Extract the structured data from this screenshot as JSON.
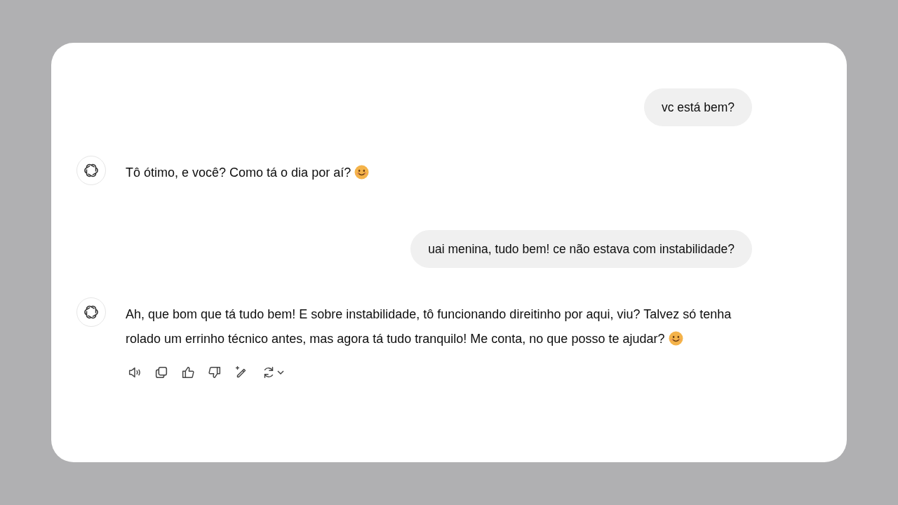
{
  "messages": [
    {
      "kind": "user",
      "text": "vc está bem?"
    },
    {
      "kind": "assistant",
      "text": "Tô ótimo, e você? Como tá o dia por aí?",
      "emoji": true
    },
    {
      "kind": "user",
      "text": "uai menina, tudo bem! ce não estava com instabilidade?"
    },
    {
      "kind": "assistant",
      "text": "Ah, que bom que tá tudo bem! E sobre instabilidade, tô funcionando direitinho por aqui, viu? Talvez só tenha rolado um errinho técnico antes, mas agora tá tudo tranquilo! Me conta, no que posso te ajudar?",
      "emoji": true,
      "actions": [
        {
          "kind": "read-aloud"
        },
        {
          "kind": "copy"
        },
        {
          "kind": "thumbs-up"
        },
        {
          "kind": "thumbs-down"
        },
        {
          "kind": "edit"
        },
        {
          "kind": "regenerate"
        }
      ]
    }
  ]
}
